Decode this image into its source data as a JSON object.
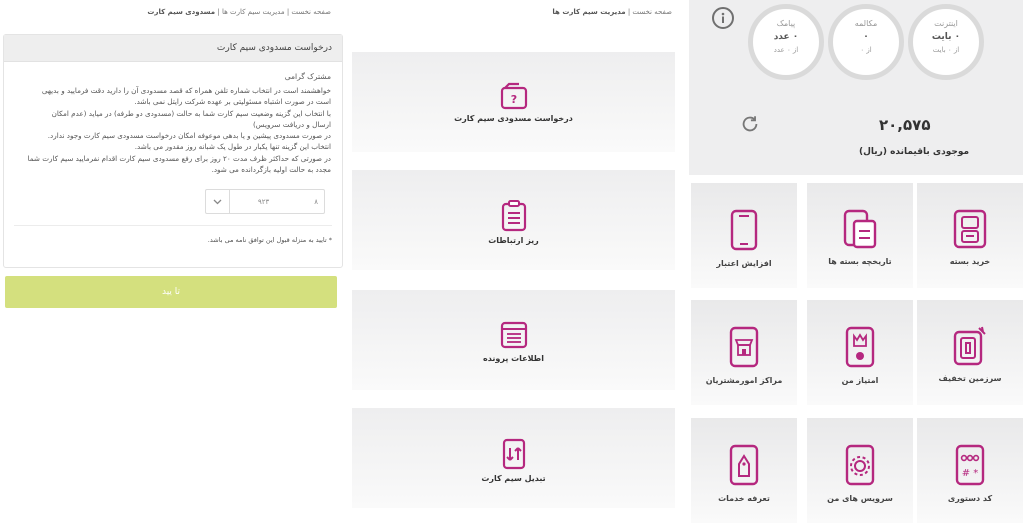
{
  "usage": {
    "internet": {
      "title": "اینترنت",
      "value": "۰ بایت",
      "sub": "از ۰ بایت"
    },
    "call": {
      "title": "مکالمه",
      "value": "۰",
      "sub": "از ۰"
    },
    "sms": {
      "title": "پیامک",
      "value": "۰ عدد",
      "sub": "از ۰ عدد"
    }
  },
  "balance": {
    "amount": "۲۰,۵۷۵",
    "label": "موجودی باقیمانده (ریال)"
  },
  "services": [
    {
      "label": "خرید بسته",
      "icon": "buy-package-icon"
    },
    {
      "label": "تاریخچه بسته ها",
      "icon": "package-history-icon"
    },
    {
      "label": "افزایش اعتبار",
      "icon": "top-up-icon"
    },
    {
      "label": "سرزمین تخفیف",
      "icon": "discount-land-icon"
    },
    {
      "label": "امتیاز من",
      "icon": "my-points-icon"
    },
    {
      "label": "مراکز امورمشتریان",
      "icon": "customer-centers-icon"
    },
    {
      "label": "کد دستوری",
      "icon": "ussd-code-icon"
    },
    {
      "label": "سرویس های من",
      "icon": "my-services-icon"
    },
    {
      "label": "تعرفه خدمات",
      "icon": "service-tariff-icon"
    }
  ],
  "simcard": {
    "breadcrumb": {
      "home": "صفحه نخست",
      "sep": "|",
      "current": "مدیریت سیم کارت ها"
    },
    "tiles": [
      {
        "label": "درخواست مسدودی سیم کارت",
        "icon": "sim-block-request-icon"
      },
      {
        "label": "ریز ارتباطات",
        "icon": "call-details-icon"
      },
      {
        "label": "اطلاعات پرونده",
        "icon": "file-info-icon"
      },
      {
        "label": "تبدیل سیم کارت",
        "icon": "sim-convert-icon"
      }
    ]
  },
  "block_form": {
    "breadcrumb": {
      "home": "صفحه نخست",
      "sep": "|",
      "parent": "مدیریت سیم کارت ها",
      "current": "مسدودی سیم کارت"
    },
    "title": "درخواست مسدودی سیم کارت",
    "greeting": "مشترک گرامی",
    "lines": [
      "خواهشمند است در انتخاب شماره تلفن همراه که قصد مسدودی آن را دارید دقت فرمایید و بدیهی",
      "است در صورت اشتباه مسئولیتی بر عهده شرکت رایتل نمی باشد.",
      "با انتخاب این گزینه وضعیت سیم کارت شما به حالت (مسدودی دو طرفه) در میاید (عدم امکان",
      "ارسال و دریافت سرویس)",
      "در صورت مسدودی پیشین و یا بدهی موعوفه امکان درخواست مسدودی سیم کارت وجود ندارد.",
      "انتخاب این گزینه تنها یکبار در طول یک شبانه روز مقدور می باشد.",
      "در صورتی که حداکثر ظرف مدت ۲۰ روز برای رفع مسدودی سیم کارت اقدام نفرمایید سیم کارت شما",
      "مجدد به حالت اولیه بازگردانده می شود."
    ],
    "phone_prefix": "۹۲۳",
    "phone_suffix": "۸",
    "accept_note": "* تایید به منزله قبول این توافق نامه می باشد.",
    "confirm_label": "تا یید"
  },
  "colors": {
    "accent": "#b5287f",
    "confirm": "#d4e07e",
    "tile": "#eeeeef"
  }
}
